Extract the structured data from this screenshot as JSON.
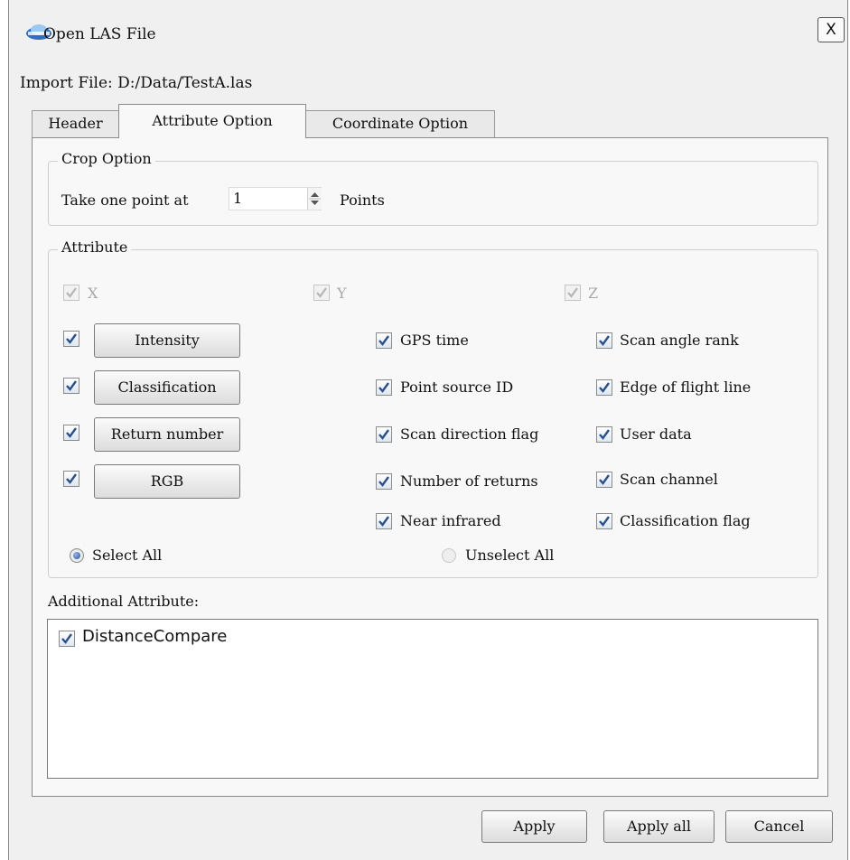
{
  "window": {
    "title": "Open LAS File",
    "close_glyph": "X",
    "import_label": "Import File: D:/Data/TestA.las"
  },
  "tabs": [
    {
      "label": "Header",
      "active": false
    },
    {
      "label": "Attribute Option",
      "active": true
    },
    {
      "label": "Coordinate Option",
      "active": false
    }
  ],
  "crop": {
    "legend": "Crop Option",
    "prefix": "Take one point at",
    "value": "1",
    "suffix": "Points"
  },
  "attribute": {
    "legend": "Attribute",
    "axes": [
      {
        "label": "X",
        "checked": true,
        "enabled": false
      },
      {
        "label": "Y",
        "checked": true,
        "enabled": false
      },
      {
        "label": "Z",
        "checked": true,
        "enabled": false
      }
    ],
    "button_rows": [
      {
        "label": "Intensity",
        "checked": true
      },
      {
        "label": "Classification",
        "checked": true
      },
      {
        "label": "Return number",
        "checked": true
      },
      {
        "label": "RGB",
        "checked": true
      }
    ],
    "middle": [
      {
        "label": "GPS time",
        "checked": true
      },
      {
        "label": "Point source ID",
        "checked": true
      },
      {
        "label": "Scan direction flag",
        "checked": true
      },
      {
        "label": "Number of returns",
        "checked": true
      },
      {
        "label": "Near infrared",
        "checked": true
      }
    ],
    "right": [
      {
        "label": "Scan angle rank",
        "checked": true
      },
      {
        "label": "Edge of flight line",
        "checked": true
      },
      {
        "label": "User data",
        "checked": true
      },
      {
        "label": "Scan channel",
        "checked": true
      },
      {
        "label": "Classification flag",
        "checked": true
      }
    ],
    "select_all": "Select All",
    "unselect_all": "Unselect All",
    "selected_mode": "select_all"
  },
  "additional": {
    "label": "Additional Attribute:",
    "items": [
      {
        "label": "DistanceCompare",
        "checked": true
      }
    ]
  },
  "footer": {
    "apply": "Apply",
    "apply_all": "Apply all",
    "cancel": "Cancel"
  }
}
